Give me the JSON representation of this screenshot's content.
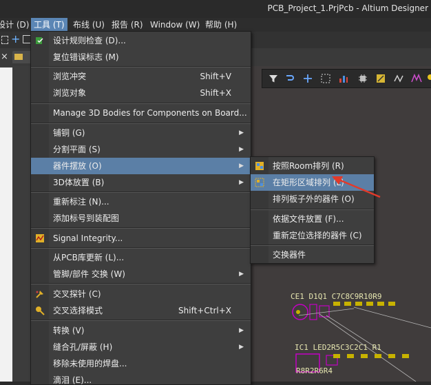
{
  "window": {
    "title": "PCB_Project_1.PrjPcb - Altium Designer"
  },
  "menubar": [
    {
      "label": "设计 (D)"
    },
    {
      "label": "工具 (T)"
    },
    {
      "label": "布线 (U)"
    },
    {
      "label": "报告 (R)"
    },
    {
      "label": "Window (W)"
    },
    {
      "label": "帮助 (H)"
    }
  ],
  "tools_menu": {
    "items": [
      {
        "label": "设计规则检查 (D)...",
        "shortcut": ""
      },
      {
        "label": "复位错误标志 (M)",
        "shortcut": ""
      },
      {
        "label": "浏览冲突",
        "shortcut": "Shift+V"
      },
      {
        "label": "浏览对象",
        "shortcut": "Shift+X"
      },
      {
        "label": "Manage 3D Bodies for Components on Board...",
        "shortcut": ""
      },
      {
        "label": "铺铜 (G)",
        "shortcut": ""
      },
      {
        "label": "分割平面 (S)",
        "shortcut": ""
      },
      {
        "label": "器件摆放 (O)",
        "shortcut": ""
      },
      {
        "label": "3D体放置 (B)",
        "shortcut": ""
      },
      {
        "label": "重新标注 (N)...",
        "shortcut": ""
      },
      {
        "label": "添加标号到装配图",
        "shortcut": ""
      },
      {
        "label": "Signal Integrity...",
        "shortcut": ""
      },
      {
        "label": "从PCB库更新 (L)...",
        "shortcut": ""
      },
      {
        "label": "管脚/部件 交换 (W)",
        "shortcut": ""
      },
      {
        "label": "交叉探针 (C)",
        "shortcut": ""
      },
      {
        "label": "交叉选择模式",
        "shortcut": "Shift+Ctrl+X"
      },
      {
        "label": "转换 (V)",
        "shortcut": ""
      },
      {
        "label": "缝合孔/屏蔽 (H)",
        "shortcut": ""
      },
      {
        "label": "移除未使用的焊盘...",
        "shortcut": ""
      },
      {
        "label": "滴泪 (E)...",
        "shortcut": ""
      }
    ]
  },
  "placement_submenu": {
    "items": [
      {
        "label": "按照Room排列 (R)"
      },
      {
        "label": "在矩形区域排列 (L)"
      },
      {
        "label": "排列板子外的器件 (O)"
      },
      {
        "label": "依据文件放置 (F)..."
      },
      {
        "label": "重新定位选择的器件 (C)"
      },
      {
        "label": "交换器件"
      }
    ]
  },
  "pcb": {
    "row1": "CE1 D1Q1 C7C8C9R10R9",
    "row2": "IC1  LED2R5C3C2C1 R1",
    "row3": "R8R2R6R4"
  },
  "colors": {
    "accent": "#5b86b5",
    "highlight": "#5b7fa6",
    "annotation_arrow": "#e23a2a"
  }
}
